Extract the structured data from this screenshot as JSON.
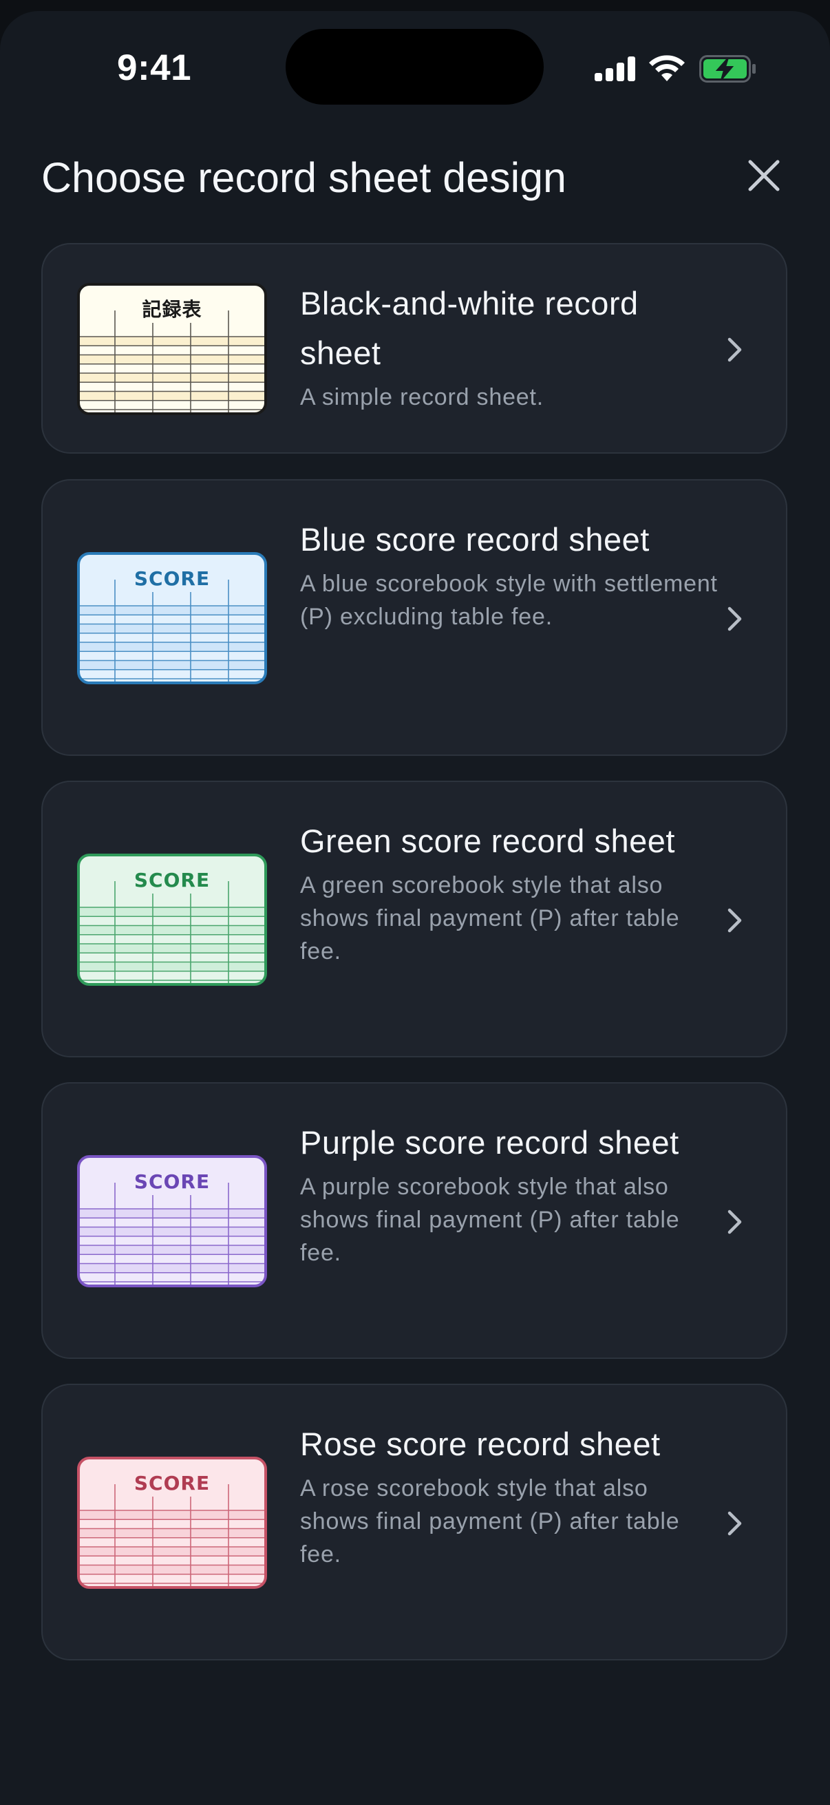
{
  "status_bar": {
    "time": "9:41"
  },
  "header": {
    "title": "Choose record sheet design"
  },
  "designs": [
    {
      "title": "Black-and-white record sheet",
      "description": "A simple record sheet.",
      "thumb_label": "記録表",
      "thumb_colors": {
        "border": "#1a1a1a",
        "fill": "#fffdf0",
        "band": "#fbf0cf",
        "line": "#5a5750",
        "text": "#1a1a1a"
      }
    },
    {
      "title": "Blue score record sheet",
      "description": "A blue scorebook style with settlement (P) excluding table fee.",
      "thumb_label": "SCORE",
      "thumb_colors": {
        "border": "#2a7bb8",
        "fill": "#e3f1fd",
        "band": "#cfe5f9",
        "line": "#4a8fc4",
        "text": "#1f6fa5"
      }
    },
    {
      "title": "Green score record sheet",
      "description": "A green scorebook style that also shows final payment (P) after table fee.",
      "thumb_label": "SCORE",
      "thumb_colors": {
        "border": "#2f9a5a",
        "fill": "#e4f5ea",
        "band": "#cfeeda",
        "line": "#4aa56d",
        "text": "#248a4d"
      }
    },
    {
      "title": "Purple score record sheet",
      "description": "A purple scorebook style that also shows final payment (P) after table fee.",
      "thumb_label": "SCORE",
      "thumb_colors": {
        "border": "#7a55c4",
        "fill": "#efe9fb",
        "band": "#e2d8f7",
        "line": "#8a68cc",
        "text": "#6a46b4"
      }
    },
    {
      "title": "Rose score record sheet",
      "description": "A rose scorebook style that also shows final payment (P) after table fee.",
      "thumb_label": "SCORE",
      "thumb_colors": {
        "border": "#c65266",
        "fill": "#fce6ea",
        "band": "#f8d3da",
        "line": "#cc6678",
        "text": "#b03c52"
      }
    }
  ]
}
